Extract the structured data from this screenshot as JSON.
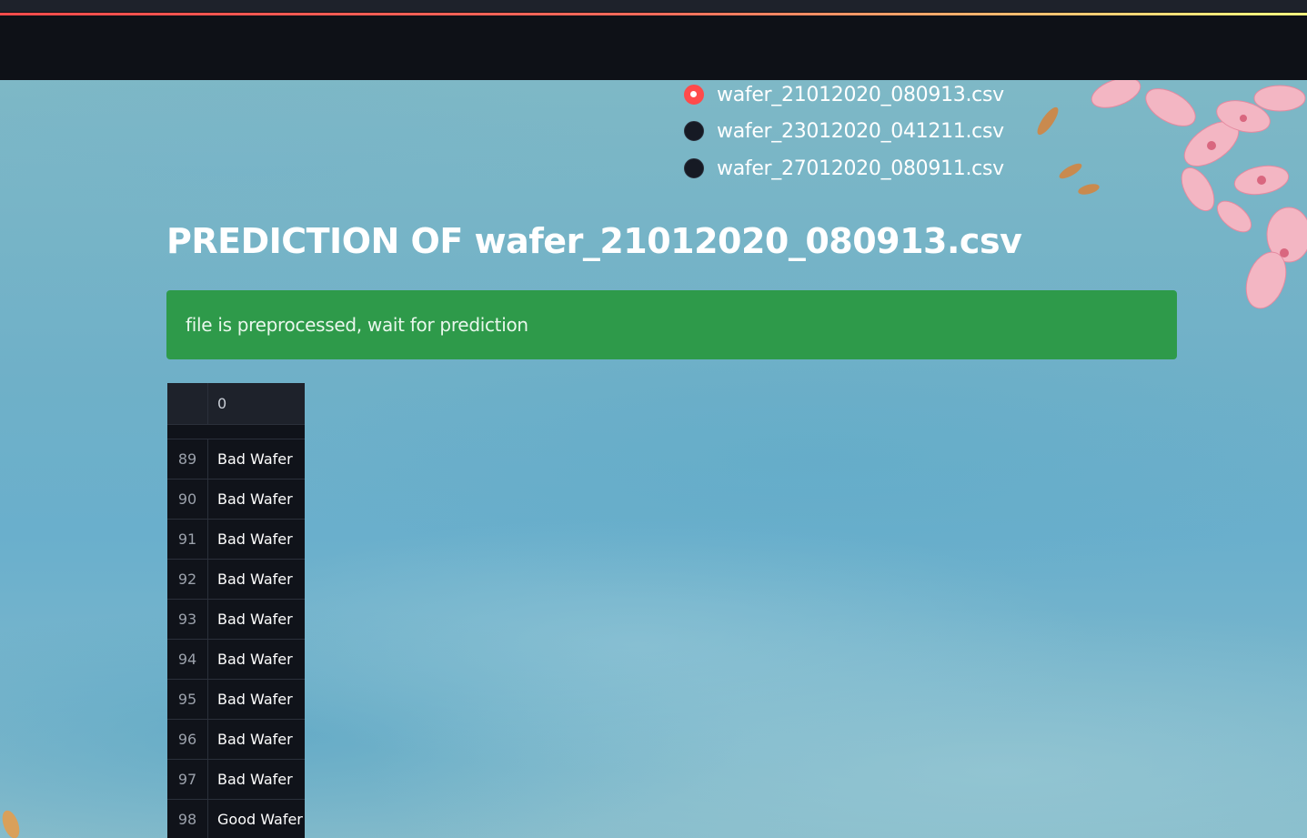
{
  "colors": {
    "topbar": "#0e1117",
    "accent": "#ff4b4b",
    "alert_bg": "#2e9a4a",
    "table_bg": "#10131a"
  },
  "files": {
    "options": [
      {
        "label": "wafer_21012020_080913.csv",
        "selected": true
      },
      {
        "label": "wafer_23012020_041211.csv",
        "selected": false
      },
      {
        "label": "wafer_27012020_080911.csv",
        "selected": false
      }
    ]
  },
  "title": "PREDICTION OF wafer_21012020_080913.csv",
  "alert": "file is preprocessed, wait for prediction",
  "table": {
    "header": "0",
    "rows": [
      {
        "index": "89",
        "value": "Bad Wafer"
      },
      {
        "index": "90",
        "value": "Bad Wafer"
      },
      {
        "index": "91",
        "value": "Bad Wafer"
      },
      {
        "index": "92",
        "value": "Bad Wafer"
      },
      {
        "index": "93",
        "value": "Bad Wafer"
      },
      {
        "index": "94",
        "value": "Bad Wafer"
      },
      {
        "index": "95",
        "value": "Bad Wafer"
      },
      {
        "index": "96",
        "value": "Bad Wafer"
      },
      {
        "index": "97",
        "value": "Bad Wafer"
      },
      {
        "index": "98",
        "value": "Good Wafer"
      }
    ]
  }
}
